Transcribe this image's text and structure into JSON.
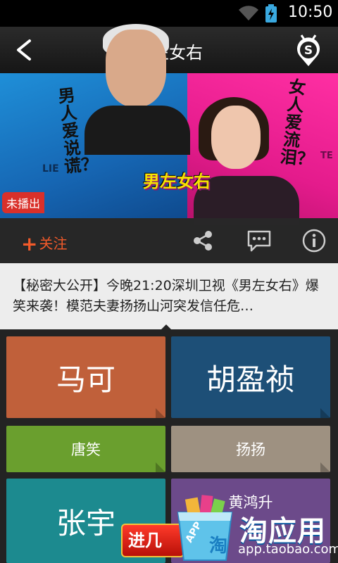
{
  "status_bar": {
    "time": "10:50",
    "wifi_icon": "wifi-icon",
    "battery_icon": "battery-charging-icon"
  },
  "header": {
    "title": "男左女右",
    "back_icon": "back-arrow-icon",
    "logo_icon": "s-badge-icon"
  },
  "banner": {
    "left_caption": "男人爱说谎？",
    "right_caption": "女人爱流泪？",
    "show_logo": "男左女右",
    "left_tag": "LIE",
    "right_tag": "TE",
    "status_badge": "未播出"
  },
  "actions": {
    "follow_label": "关注",
    "follow_symbol": "+",
    "share_icon": "share-icon",
    "comment_icon": "comment-icon",
    "info_icon": "info-icon",
    "accent_color": "#f25a2a"
  },
  "description": "【秘密大公开】今晚21:20深圳卫视《男左女右》爆笑来袭！模范夫妻扬扬山河突发信任危…",
  "people": [
    "马可",
    "胡盈祯",
    "唐笑",
    "扬扬",
    "张宇",
    "黄鸿升"
  ],
  "ad": {
    "button_text": "进几",
    "app_name": "淘应用",
    "url": "app.taobao.com",
    "bag_labels": [
      "APP",
      "淘"
    ]
  }
}
